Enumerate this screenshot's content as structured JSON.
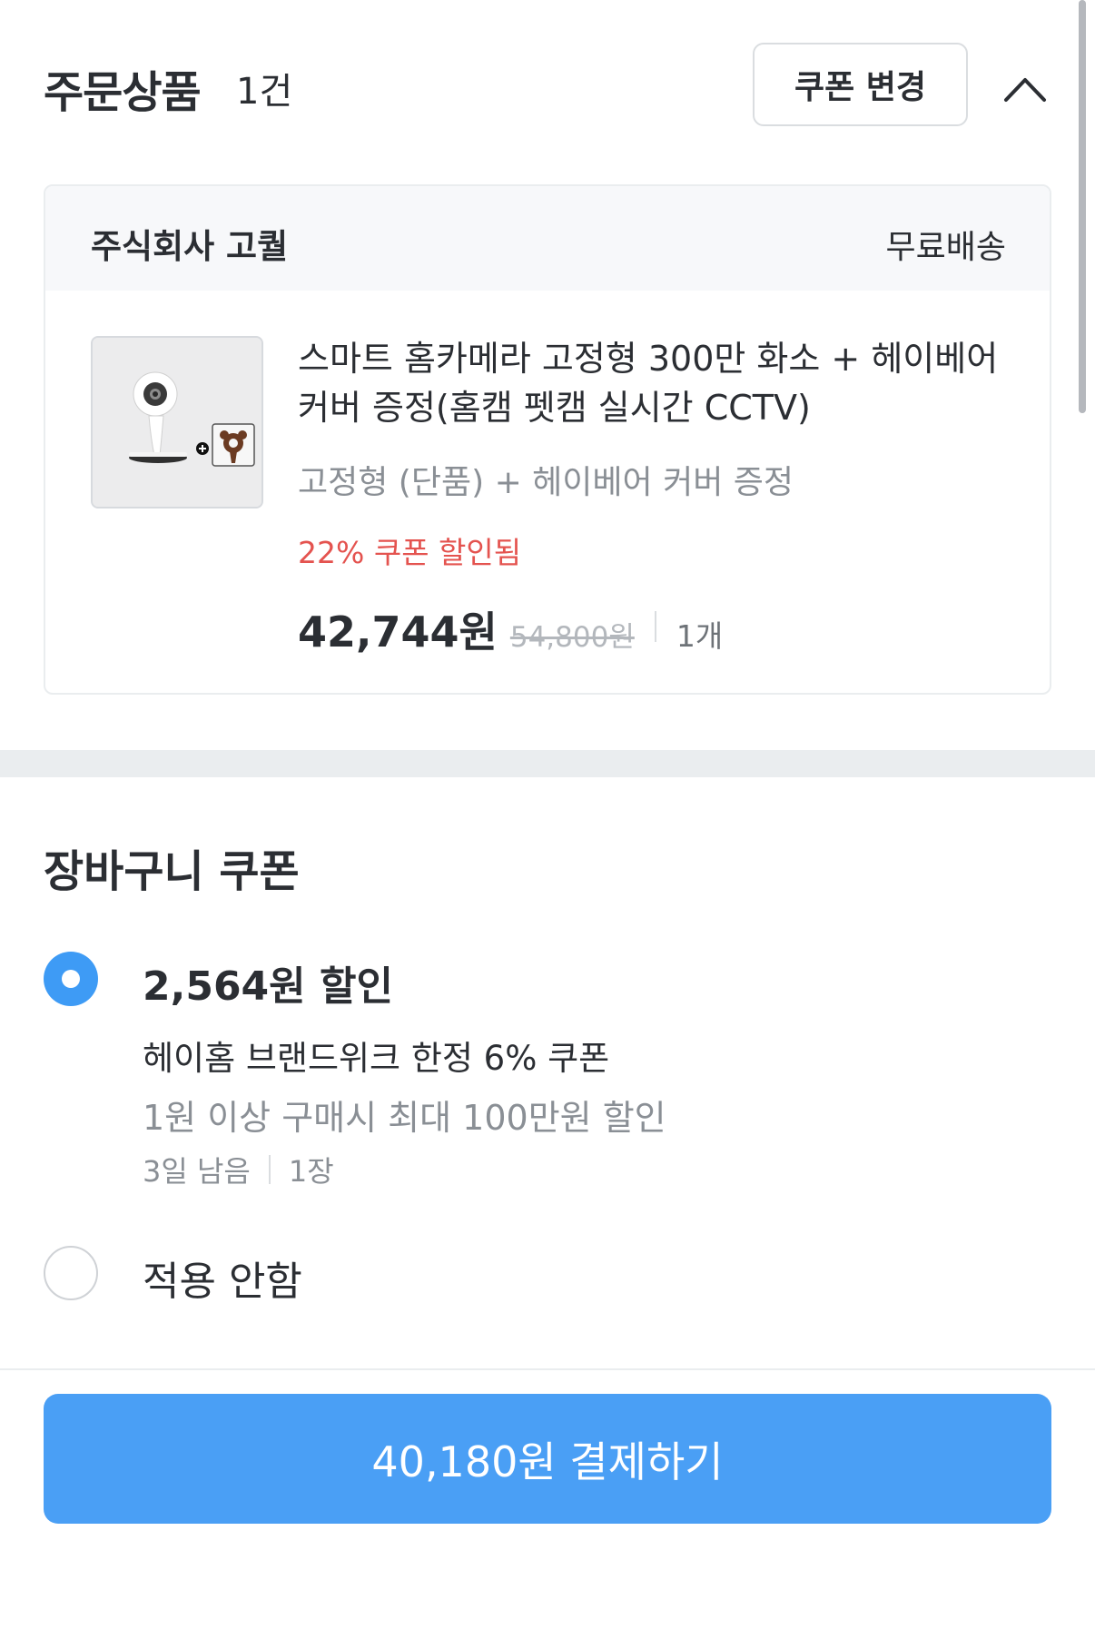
{
  "header": {
    "title": "주문상품",
    "count": "1건",
    "coupon_button_label": "쿠폰 변경",
    "collapse_icon": "chevron-up-icon"
  },
  "order_card": {
    "seller": "주식회사 고퀄",
    "shipping": "무료배송",
    "product": {
      "image_icon": "smart-camera-product-image",
      "name": "스마트 홈카메라 고정형 300만 화소 + 헤이베어 커버 증정(홈캠 펫캠 실시간 CCTV)",
      "option": "고정형 (단품) + 헤이베어 커버 증정",
      "discount_note": "22% 쿠폰 할인됨",
      "price": "42,744원",
      "original_price": "54,800원",
      "quantity": "1개"
    }
  },
  "cart_coupon": {
    "title": "장바구니 쿠폰",
    "options": [
      {
        "selected": true,
        "amount": "2,564원 할인",
        "name": "헤이홈 브랜드위크 한정 6% 쿠폰",
        "condition": "1원 이상 구매시 최대 100만원 할인",
        "remaining": "3일 남음",
        "count": "1장"
      },
      {
        "selected": false,
        "label": "적용 안함"
      }
    ]
  },
  "checkout": {
    "pay_button_label": "40,180원 결제하기"
  },
  "colors": {
    "accent": "#4a9ff5",
    "radio_selected": "#3e9bf5",
    "discount_red": "#e4534f",
    "muted_text": "#8a8f95",
    "section_band": "#eaedef"
  }
}
